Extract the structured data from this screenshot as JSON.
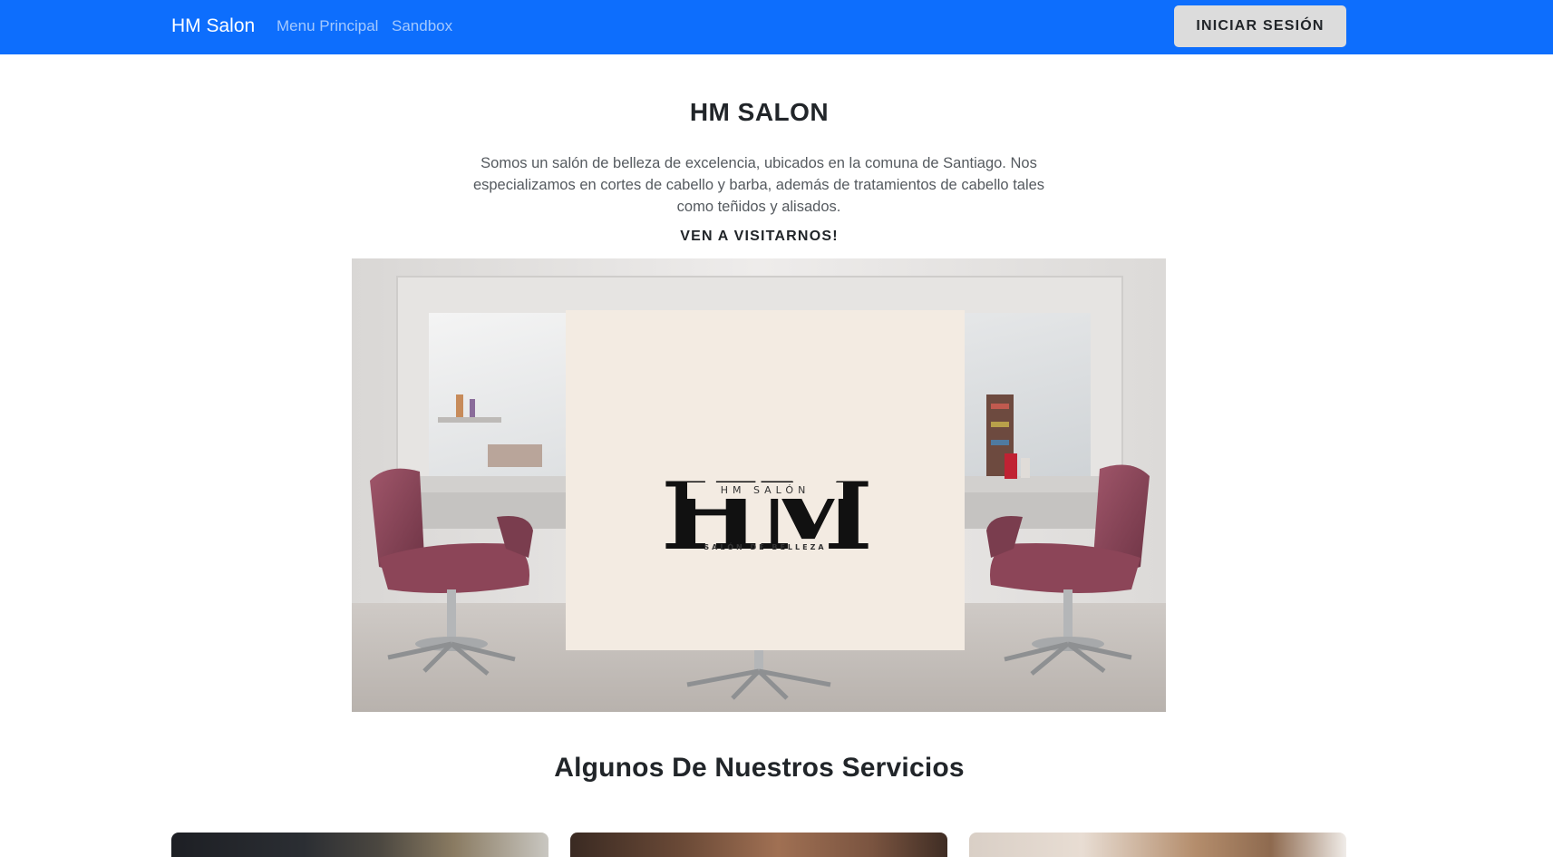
{
  "navbar": {
    "brand": "HM Salon",
    "links": [
      {
        "label": "Menu Principal"
      },
      {
        "label": "Sandbox"
      }
    ],
    "login_label": "INICIAR SESIÓN",
    "background_color": "#0d6efd"
  },
  "hero": {
    "title": "HM SALON",
    "description": "Somos un salón de belleza de excelencia, ubicados en la comuna de Santiago. Nos especializamos en cortes de cabello y barba, además de tratamientos de cabello tales como teñidos y alisados.",
    "cta": "VEN A VISITARNOS!",
    "logo": {
      "monogram": "HM",
      "name": "HM SALÓN",
      "tagline": "SALÓN DE BELLEZA"
    }
  },
  "services": {
    "title": "Algunos De Nuestros Servicios"
  }
}
